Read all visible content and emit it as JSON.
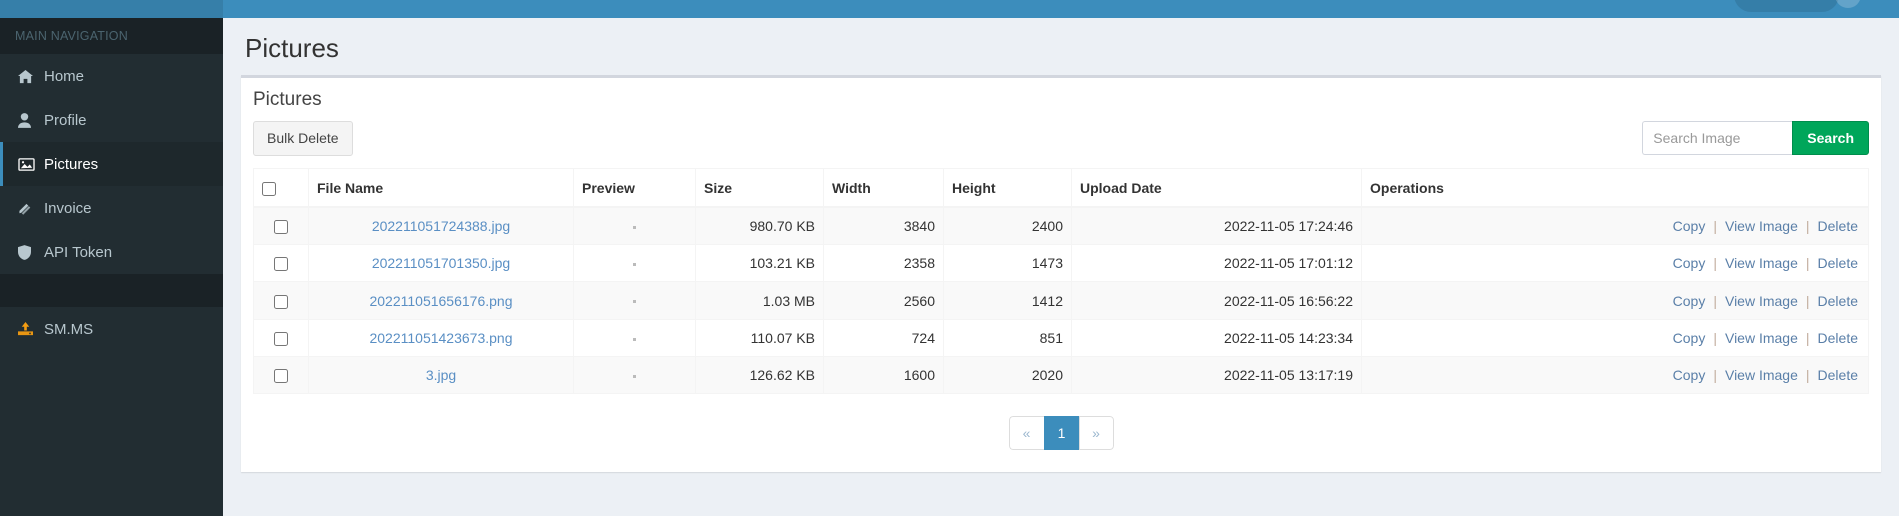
{
  "sidebar": {
    "header_label": "MAIN NAVIGATION",
    "items": [
      {
        "label": "Home",
        "icon": "home-icon"
      },
      {
        "label": "Profile",
        "icon": "user-icon"
      },
      {
        "label": "Pictures",
        "icon": "image-icon"
      },
      {
        "label": "Invoice",
        "icon": "invoice-icon"
      },
      {
        "label": "API Token",
        "icon": "shield-icon"
      }
    ],
    "external": {
      "label": "SM.MS",
      "icon": "upload-icon"
    }
  },
  "header": {
    "page_title": "Pictures"
  },
  "box": {
    "title": "Pictures"
  },
  "toolbar": {
    "bulk_delete_label": "Bulk Delete",
    "search_placeholder": "Search Image",
    "search_value": "",
    "search_button_label": "Search"
  },
  "table": {
    "columns": [
      "File Name",
      "Preview",
      "Size",
      "Width",
      "Height",
      "Upload Date",
      "Operations"
    ],
    "operations": {
      "copy": "Copy",
      "view": "View Image",
      "delete": "Delete",
      "separator": "|"
    },
    "rows": [
      {
        "file_name": "202211051724388.jpg",
        "preview": "",
        "size": "980.70 KB",
        "width": "3840",
        "height": "2400",
        "upload_date": "2022-11-05 17:24:46"
      },
      {
        "file_name": "202211051701350.jpg",
        "preview": "",
        "size": "103.21 KB",
        "width": "2358",
        "height": "1473",
        "upload_date": "2022-11-05 17:01:12"
      },
      {
        "file_name": "202211051656176.png",
        "preview": "",
        "size": "1.03 MB",
        "width": "2560",
        "height": "1412",
        "upload_date": "2022-11-05 16:56:22"
      },
      {
        "file_name": "202211051423673.png",
        "preview": "",
        "size": "110.07 KB",
        "width": "724",
        "height": "851",
        "upload_date": "2022-11-05 14:23:34"
      },
      {
        "file_name": "3.jpg",
        "preview": "",
        "size": "126.62 KB",
        "width": "1600",
        "height": "2020",
        "upload_date": "2022-11-05 13:17:19"
      }
    ]
  },
  "pagination": {
    "prev_label": "«",
    "next_label": "»",
    "pages": [
      "1"
    ],
    "active_page": "1"
  },
  "colors": {
    "topbar": "#3c8dbc",
    "sidebar": "#222d32",
    "accent": "#3c8dbc",
    "search_button": "#00a65a",
    "link": "#5a8fc4",
    "external_icon": "#f39c12"
  }
}
